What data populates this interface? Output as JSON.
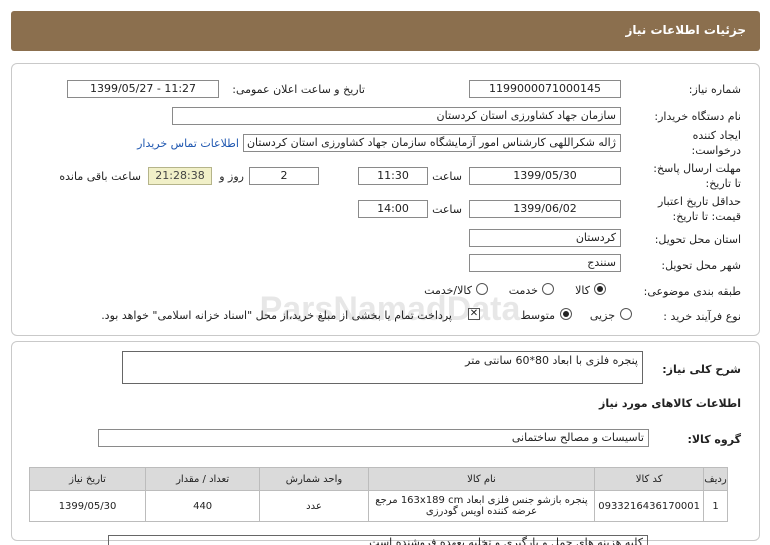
{
  "page_title": "جزئیات اطلاعات نیاز",
  "fields": {
    "need_number_label": "شماره نیاز:",
    "need_number": "1199000071000145",
    "announce_label": "تاریخ و ساعت اعلان عمومی:",
    "announce_value": "1399/05/27 - 11:27",
    "buyer_org_label": "نام دستگاه خریدار:",
    "buyer_org": "سازمان جهاد کشاورزی استان کردستان",
    "creator_label_1": "ایجاد کننده",
    "creator_label_2": "درخواست:",
    "creator": "ژاله شکراللهی کارشناس امور آزمایشگاه سازمان جهاد کشاورزی استان کردستان",
    "contact_link": "اطلاعات تماس خریدار",
    "send_deadline_label_1": "مهلت ارسال پاسخ:",
    "send_deadline_label_2": "تا تاریخ:",
    "send_date": "1399/05/30",
    "time_label": "ساعت",
    "send_time": "11:30",
    "days_value": "2",
    "days_label": "روز و",
    "remaining_time": "21:28:38",
    "remaining_label": "ساعت باقی مانده",
    "validity_label_1": "حداقل تاریخ اعتبار",
    "validity_label_2": "قیمت: تا تاریخ:",
    "validity_date": "1399/06/02",
    "validity_time": "14:00",
    "province_label": "استان محل تحویل:",
    "province": "کردستان",
    "city_label": "شهر محل تحویل:",
    "city": "سنندج",
    "category_label": "طبقه بندی موضوعی:",
    "category_options": [
      "کالا",
      "خدمت",
      "کالا/خدمت"
    ],
    "process_label": "نوع فرآیند خرید :",
    "process_options": [
      "جزیی",
      "متوسط"
    ],
    "payment_note": "پرداخت تمام یا بخشی از مبلغ خرید،از محل \"اسناد خزانه اسلامی\" خواهد بود."
  },
  "description": {
    "label": "شرح کلی نیاز:",
    "value": "پنجره فلزی با ابعاد 80*60 سانتی متر"
  },
  "goods_section_title": "اطلاعات کالاهای مورد نیاز",
  "goods_group_label": "گروه کالا:",
  "goods_group": "تاسیسات و مصالح ساختمانی",
  "table": {
    "headers": [
      "ردیف",
      "کد کالا",
      "نام کالا",
      "واحد شمارش",
      "تعداد / مقدار",
      "تاریخ نیاز"
    ],
    "rows": [
      [
        "1",
        "0933216436170001",
        "پنجره بازشو جنس فلزی ابعاد 163x189 cm مرجع عرضه کننده اویس گودرزی",
        "عدد",
        "440",
        "1399/05/30"
      ]
    ]
  },
  "bottom_note": "کلیه هزینه های حمل و بارگیری و تخلیه بعهده فروشنده است"
}
